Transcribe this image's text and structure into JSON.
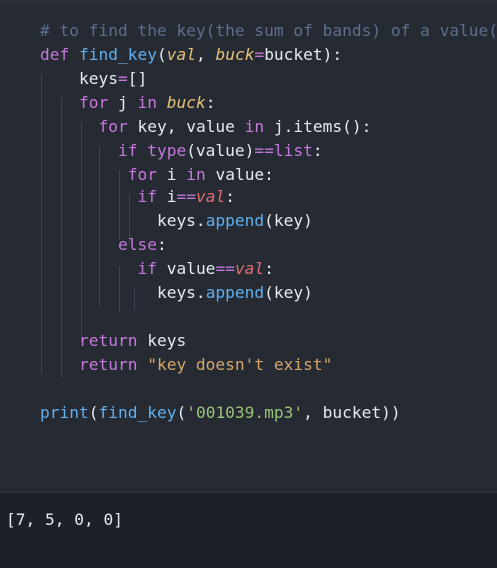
{
  "code_lines": [
    {
      "id": "l1",
      "tokens": [
        {
          "t": "# to find the key(the sum of bands) of a value(a",
          "c": "comment"
        }
      ]
    },
    {
      "id": "l2",
      "tokens": [
        {
          "t": "def ",
          "c": "kw"
        },
        {
          "t": "find_key",
          "c": "fn"
        },
        {
          "t": "(",
          "c": "white"
        },
        {
          "t": "val",
          "c": "param"
        },
        {
          "t": ", ",
          "c": "white"
        },
        {
          "t": "buck",
          "c": "param"
        },
        {
          "t": "=",
          "c": "op"
        },
        {
          "t": "bucket",
          "c": "white"
        },
        {
          "t": "):",
          "c": "white"
        }
      ]
    },
    {
      "id": "l3",
      "tokens": [
        {
          "t": "    keys",
          "c": "white"
        },
        {
          "t": "=",
          "c": "op"
        },
        {
          "t": "[]",
          "c": "white"
        }
      ]
    },
    {
      "id": "l4",
      "tokens": [
        {
          "t": "    for ",
          "c": "kw"
        },
        {
          "t": "j ",
          "c": "white"
        },
        {
          "t": "in ",
          "c": "kw"
        },
        {
          "t": "buck",
          "c": "param"
        },
        {
          "t": ":",
          "c": "white"
        }
      ]
    },
    {
      "id": "l5",
      "tokens": [
        {
          "t": "      for ",
          "c": "kw"
        },
        {
          "t": "key, value ",
          "c": "white"
        },
        {
          "t": "in ",
          "c": "kw"
        },
        {
          "t": "j.items():",
          "c": "white"
        }
      ]
    },
    {
      "id": "l6",
      "tokens": [
        {
          "t": "        if ",
          "c": "kw"
        },
        {
          "t": "type",
          "c": "builtin"
        },
        {
          "t": "(value)",
          "c": "white"
        },
        {
          "t": "==",
          "c": "op"
        },
        {
          "t": "list",
          "c": "builtin"
        },
        {
          "t": ":",
          "c": "white"
        }
      ]
    },
    {
      "id": "l7",
      "tokens": [
        {
          "t": "         for ",
          "c": "kw"
        },
        {
          "t": "i ",
          "c": "white"
        },
        {
          "t": "in ",
          "c": "kw"
        },
        {
          "t": "value:",
          "c": "white"
        }
      ]
    },
    {
      "id": "l8",
      "tokens": [
        {
          "t": "          if ",
          "c": "kw"
        },
        {
          "t": "i",
          "c": "white"
        },
        {
          "t": "==",
          "c": "op"
        },
        {
          "t": "val",
          "c": "var"
        },
        {
          "t": ":",
          "c": "white"
        }
      ]
    },
    {
      "id": "l9",
      "tokens": [
        {
          "t": "            keys.",
          "c": "white"
        },
        {
          "t": "append",
          "c": "fn"
        },
        {
          "t": "(key)",
          "c": "white"
        }
      ]
    },
    {
      "id": "l10",
      "tokens": [
        {
          "t": "        else",
          "c": "kw"
        },
        {
          "t": ":",
          "c": "white"
        }
      ]
    },
    {
      "id": "l11",
      "tokens": [
        {
          "t": "          if ",
          "c": "kw"
        },
        {
          "t": "value",
          "c": "white"
        },
        {
          "t": "==",
          "c": "op"
        },
        {
          "t": "val",
          "c": "var"
        },
        {
          "t": ":",
          "c": "white"
        }
      ]
    },
    {
      "id": "l12",
      "tokens": [
        {
          "t": "            keys.",
          "c": "white"
        },
        {
          "t": "append",
          "c": "fn"
        },
        {
          "t": "(key)",
          "c": "white"
        }
      ]
    },
    {
      "id": "l13",
      "tokens": []
    },
    {
      "id": "l14",
      "tokens": [
        {
          "t": "    return ",
          "c": "kw"
        },
        {
          "t": "keys",
          "c": "white"
        }
      ]
    },
    {
      "id": "l15",
      "tokens": [
        {
          "t": "    return ",
          "c": "kw"
        },
        {
          "t": "\"key doesn't exist\"",
          "c": "tan"
        }
      ]
    },
    {
      "id": "l16",
      "tokens": []
    },
    {
      "id": "l17",
      "tokens": [
        {
          "t": "print",
          "c": "fn"
        },
        {
          "t": "(",
          "c": "white"
        },
        {
          "t": "find_key",
          "c": "fn"
        },
        {
          "t": "(",
          "c": "white"
        },
        {
          "t": "'001039.mp3'",
          "c": "str"
        },
        {
          "t": ", bucket",
          "c": "white"
        },
        {
          "t": "))",
          "c": "white"
        }
      ]
    }
  ],
  "output": {
    "text": "[7, 5, 0, 0]"
  },
  "colors": {
    "background": "#262a33",
    "output_background": "#1e2027",
    "keyword": "#c678dd",
    "function": "#61afef",
    "parameter": "#e5c07b",
    "string": "#98c379",
    "comment": "#5c6f8e"
  }
}
